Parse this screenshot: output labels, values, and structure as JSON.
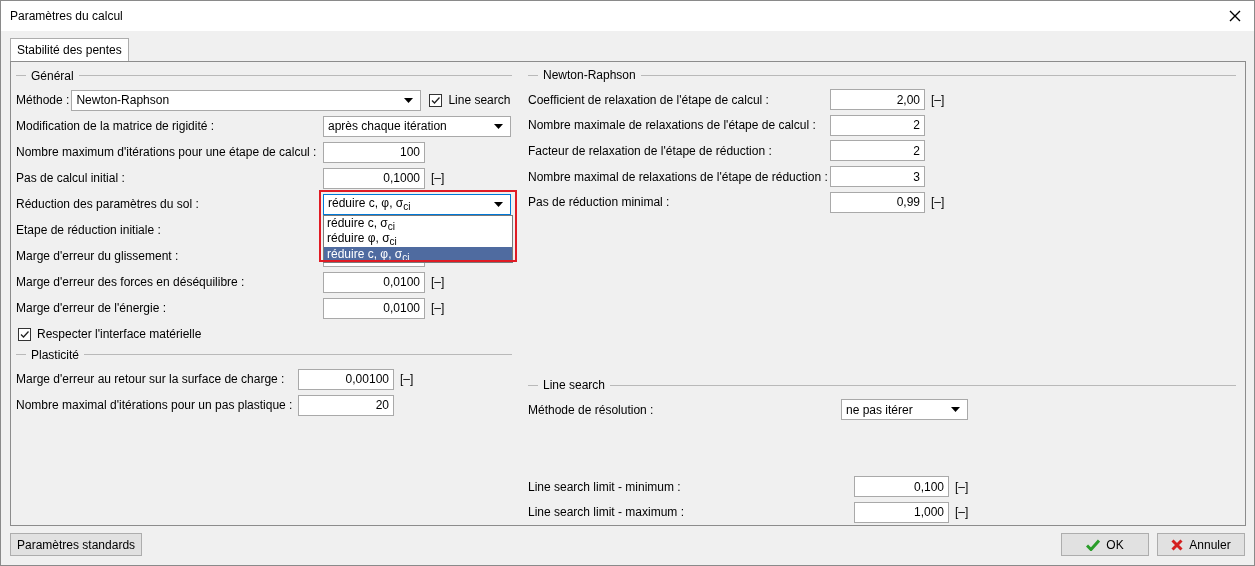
{
  "window": {
    "title": "Paramètres du calcul"
  },
  "tabs": [
    {
      "label": "Stabilité des pentes",
      "selected": true
    }
  ],
  "general": {
    "title": "Général",
    "method": {
      "label": "Méthode :",
      "value": "Newton-Raphson"
    },
    "line_search": {
      "label": "Line search",
      "checked": true
    },
    "rows": [
      {
        "kind": "select",
        "label": "Modification de la matrice de rigidité :",
        "value": "après chaque itération"
      },
      {
        "kind": "number",
        "label": "Nombre maximum d'itérations pour une étape de calcul :",
        "value": "100"
      },
      {
        "kind": "number",
        "label": "Pas de calcul initial :",
        "value": "0,1000",
        "unit": "[–]"
      },
      {
        "kind": "select",
        "label": "Réduction des paramètres du sol :",
        "value": "réduire c, φ, σ$_{ci}$",
        "expanded": true,
        "options": [
          {
            "label": "réduire c, σ$_{ci}$",
            "selected": false
          },
          {
            "label": "réduire φ, σ$_{ci}$",
            "selected": false
          },
          {
            "label": "réduire c, φ, σ$_{ci}$",
            "selected": true
          }
        ]
      },
      {
        "kind": "covered",
        "label": "Etape de réduction initiale :"
      },
      {
        "kind": "covered",
        "label": "Marge d'erreur du glissement :"
      },
      {
        "kind": "number",
        "label": "Marge d'erreur des forces en déséquilibre :",
        "value": "0,0100",
        "unit": "[–]"
      },
      {
        "kind": "number",
        "label": "Marge d'erreur de l'énergie :",
        "value": "0,0100",
        "unit": "[–]"
      }
    ],
    "interface": {
      "label": "Respecter l'interface matérielle",
      "checked": true
    }
  },
  "plasticity": {
    "title": "Plasticité",
    "rows": [
      {
        "kind": "number",
        "label": "Marge d'erreur au retour sur la surface de charge :",
        "value": "0,00100",
        "unit": "[–]"
      },
      {
        "kind": "number",
        "label": "Nombre maximal d'itérations pour un pas plastique :",
        "value": "20"
      }
    ]
  },
  "newton_raphson": {
    "title": "Newton-Raphson",
    "rows": [
      {
        "kind": "number",
        "label": "Coefficient de relaxation de l'étape de calcul :",
        "value": "2,00",
        "unit": "[–]"
      },
      {
        "kind": "number",
        "label": "Nombre maximale de relaxations de l'étape de calcul :",
        "value": "2"
      },
      {
        "kind": "number",
        "label": "Facteur de relaxation de l'étape de réduction :",
        "value": "2"
      },
      {
        "kind": "number",
        "label": "Nombre maximal de relaxations de l'étape de réduction :",
        "value": "3"
      },
      {
        "kind": "number",
        "label": "Pas de réduction minimal :",
        "value": "0,99",
        "unit": "[–]"
      }
    ]
  },
  "line_search": {
    "title": "Line search",
    "method": {
      "label": "Méthode de résolution :",
      "value": "ne pas itérer"
    },
    "rows": [
      {
        "kind": "number",
        "label": "Line search limit - minimum :",
        "value": "0,100",
        "unit": "[–]"
      },
      {
        "kind": "number",
        "label": "Line search limit - maximum :",
        "value": "1,000",
        "unit": "[–]"
      }
    ]
  },
  "buttons": {
    "defaults": "Paramètres standards",
    "ok": "OK",
    "cancel": "Annuler"
  }
}
